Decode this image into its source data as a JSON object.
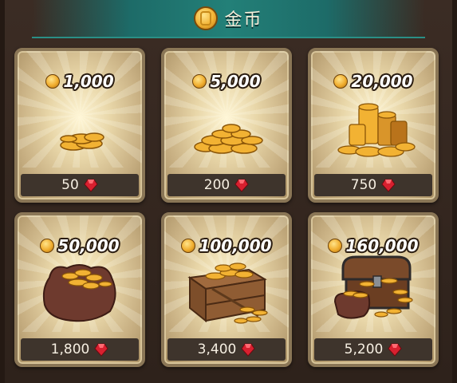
{
  "header": {
    "title": "金币",
    "icon": "gold-coin-icon"
  },
  "packs": [
    {
      "amount": "1,000",
      "price": "50",
      "art": "small-coin-pile"
    },
    {
      "amount": "5,000",
      "price": "200",
      "art": "coin-pile"
    },
    {
      "amount": "20,000",
      "price": "750",
      "art": "coin-stacks"
    },
    {
      "amount": "50,000",
      "price": "1,800",
      "art": "coin-sack"
    },
    {
      "amount": "100,000",
      "price": "3,400",
      "art": "coin-crate"
    },
    {
      "amount": "160,000",
      "price": "5,200",
      "art": "treasure-chest"
    }
  ],
  "colors": {
    "gem": "#d8202f",
    "coin": "#f0ad2e",
    "header": "#1d6b68"
  }
}
